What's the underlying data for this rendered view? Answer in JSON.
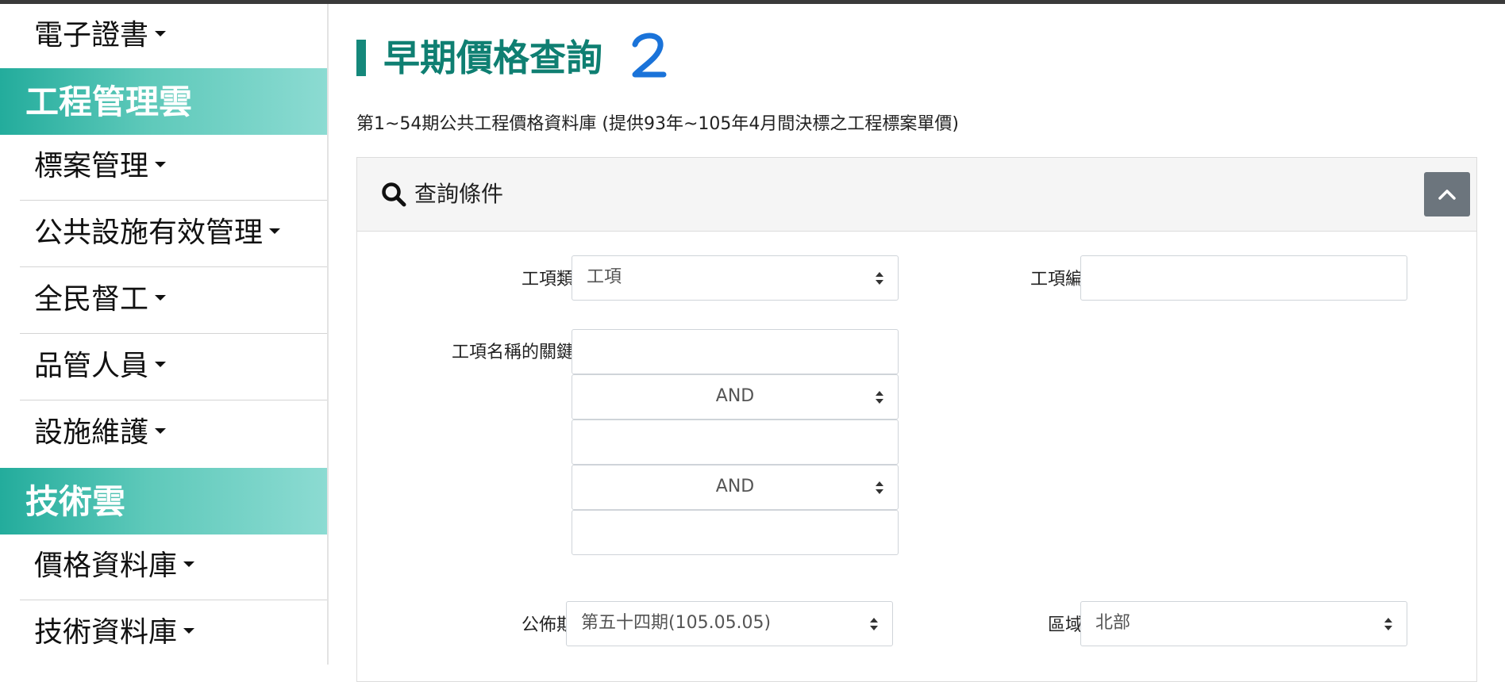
{
  "sidebar": {
    "items_top": [
      {
        "label": "電子證書"
      }
    ],
    "section_1": {
      "title": "工程管理雲"
    },
    "items_mid": [
      {
        "label": "標案管理"
      },
      {
        "label": "公共設施有效管理"
      },
      {
        "label": "全民督工"
      },
      {
        "label": "品管人員"
      },
      {
        "label": "設施維護"
      }
    ],
    "section_2": {
      "title": "技術雲"
    },
    "items_bottom": [
      {
        "label": "價格資料庫"
      },
      {
        "label": "技術資料庫"
      }
    ]
  },
  "main": {
    "title": "早期價格查詢",
    "annotation": "2",
    "description": "第1~54期公共工程價格資料庫 (提供93年~105年4月間決標之工程標案單價)",
    "panel": {
      "header": "查詢條件",
      "fields": {
        "category_label": "工項類別",
        "category_value": "工項",
        "code_label": "工項編碼",
        "code_value": "",
        "keyword_label": "工項名稱的關鍵字",
        "keyword_1": "",
        "operator_1": "AND",
        "keyword_2": "",
        "operator_2": "AND",
        "keyword_3": "",
        "period_label": "公佈期數",
        "period_value": "第五十四期(105.05.05)",
        "region_label": "區域別",
        "region_value": "北部"
      }
    }
  },
  "colors": {
    "brand_teal": "#0f7f72",
    "section_gradient_start": "#23ac9c",
    "section_gradient_end": "#8cdbd2",
    "annotation_blue": "#1a73d9",
    "button_gray": "#6c757d"
  },
  "icons": [
    "caret-down-icon",
    "search-icon",
    "chevron-up-icon",
    "select-arrows-icon"
  ]
}
